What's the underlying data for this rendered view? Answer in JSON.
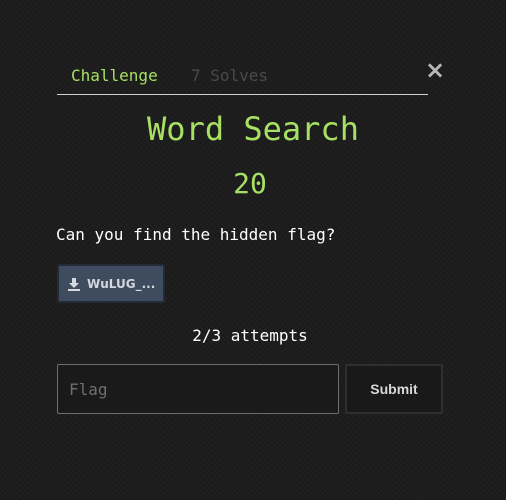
{
  "tabs": {
    "challenge_label": "Challenge",
    "solves_label": "7 Solves"
  },
  "close_icon": "×",
  "challenge": {
    "name": "Word Search",
    "points": "20",
    "description": "Can you find the hidden flag?"
  },
  "file": {
    "label": "WuLUG_...",
    "icon": "download-icon"
  },
  "attempts": "2/3 attempts",
  "flag_input": {
    "placeholder": "Flag",
    "value": ""
  },
  "submit_label": "Submit",
  "colors": {
    "accent": "#a8e063",
    "background": "#1d1d1d",
    "file_button": "#3f4b5e",
    "muted_tab": "#4a4a4a"
  }
}
